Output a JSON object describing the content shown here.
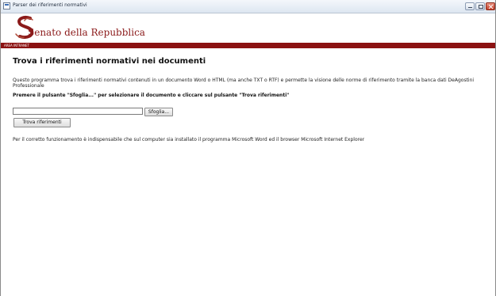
{
  "window": {
    "title": "Parser dei riferimenti normativi"
  },
  "header": {
    "site_title": "Senato della Repubblica",
    "area_label": "AREA INTRANET",
    "brand_color": "#8b1111"
  },
  "main": {
    "page_title": "Trova i riferimenti normativi nei documenti",
    "description": "Questo programma trova i riferimenti normativi contenuti in un documento Word o HTML (ma anche TXT o RTF) e permette la visione delle norme di riferimento tramite la banca dati DeAgostini Professionale",
    "instruction": "Premere il pulsante \"Sfoglia...\" per selezionare il documento e cliccare sul pulsante \"Trova riferimenti\"",
    "file_input_value": "",
    "browse_label": "Sfoglia...",
    "find_label": "Trova riferimenti",
    "note": "Per il corretto funzionamento è indispensabile che sul computer sia installato il programma Microsoft Word ed il browser Microsoft Internet Explorer"
  }
}
